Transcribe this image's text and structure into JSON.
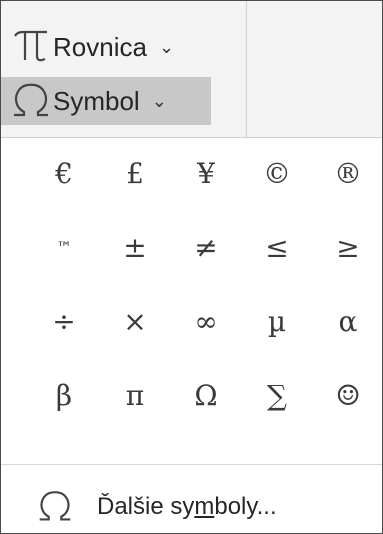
{
  "ribbon": {
    "equation_label": "Rovnica",
    "equation_icon": "pi-icon",
    "symbol_label": "Symbol",
    "symbol_icon": "omega-icon",
    "chevron": "⌄"
  },
  "symbols": [
    "€",
    "£",
    "¥",
    "©",
    "®",
    "™",
    "±",
    "≠",
    "≤",
    "≥",
    "÷",
    "×",
    "∞",
    "µ",
    "α",
    "β",
    "π",
    "Ω",
    "∑",
    "☺"
  ],
  "more": {
    "label_before": "Ďalšie sy",
    "label_underlined": "m",
    "label_after": "boly...",
    "icon": "omega-icon"
  },
  "colors": {
    "ribbon_bg": "#f3f3f3",
    "selected_bg": "#c8c8c8",
    "text": "#3a3a3a"
  }
}
